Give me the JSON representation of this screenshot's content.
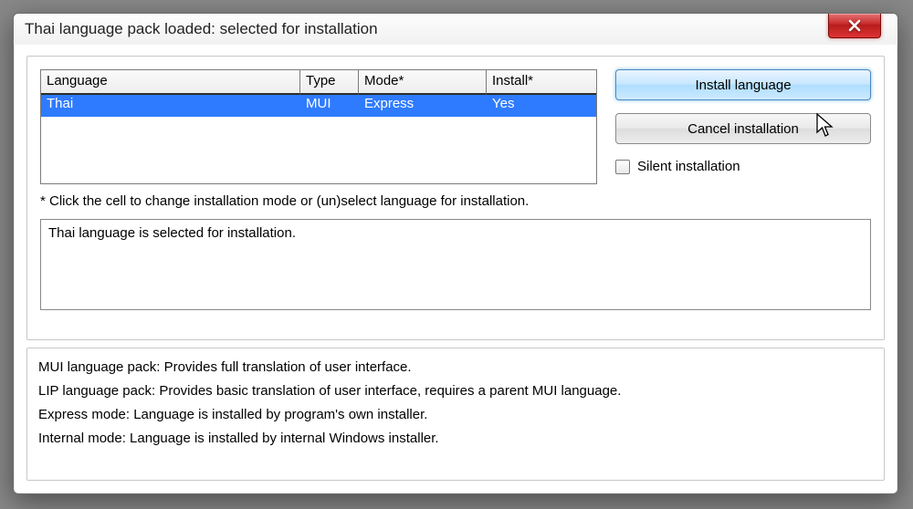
{
  "window": {
    "title": "Thai language pack loaded: selected for installation"
  },
  "table": {
    "headers": {
      "language": "Language",
      "type": "Type",
      "mode": "Mode*",
      "install": "Install*"
    },
    "rows": [
      {
        "language": "Thai",
        "type": "MUI",
        "mode": "Express",
        "install": "Yes"
      }
    ]
  },
  "side": {
    "install_label": "Install language",
    "cancel_label": "Cancel installation",
    "silent_label": "Silent installation",
    "silent_checked": false
  },
  "hint": "* Click the cell to change installation mode or (un)select language for installation.",
  "status": "Thai language is selected for installation.",
  "info": {
    "l1": "MUI language pack: Provides full translation of user interface.",
    "l2": "LIP language pack: Provides basic translation of user interface, requires a parent MUI language.",
    "l3": "Express mode: Language is installed by program's own installer.",
    "l4": "Internal mode: Language is installed by internal Windows installer."
  }
}
